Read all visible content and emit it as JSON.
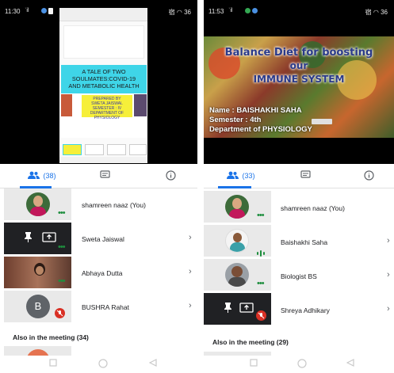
{
  "left_phone": {
    "status": {
      "time": "11:30",
      "signal": "ʾil",
      "right": "宿 ◠ 36"
    },
    "presentation": {
      "title_line1": "A TALE OF TWO",
      "title_line2": "SOULMATES:COVID-19",
      "title_line3": "AND METABOLIC HEALTH",
      "prepared_line1": "PREPARED BY",
      "prepared_line2": "SWETA JAISWAL",
      "prepared_line3": "SEMESTER : IV",
      "prepared_line4": "DEPARTMENT OF PHYSIOLOGY"
    },
    "tabs": {
      "people_count": "(38)"
    },
    "participants": [
      {
        "name": "shamreen naaz (You)"
      },
      {
        "name": "Sweta Jaiswal"
      },
      {
        "name": "Abhaya Dutta"
      },
      {
        "name": "BUSHRA Rahat",
        "initial": "B"
      }
    ],
    "also_in_meeting": "Also in the meeting (34)"
  },
  "right_phone": {
    "status": {
      "time": "11:53",
      "signal": "ʾil",
      "right": "宿 ◠ 36"
    },
    "presentation": {
      "title_line1": "Balance Diet for boosting",
      "title_line2": "our",
      "title_line3": "IMMUNE SYSTEM",
      "name_line": "Name : BAISHAKHI SAHA",
      "semester_line": "Semester : 4th",
      "department_line": "Department of PHYSIOLOGY"
    },
    "tabs": {
      "people_count": "(33)"
    },
    "participants": [
      {
        "name": "shamreen naaz (You)"
      },
      {
        "name": "Baishakhi Saha"
      },
      {
        "name": "Biologist BS"
      },
      {
        "name": "Shreya Adhikary"
      }
    ],
    "also_in_meeting": "Also in the meeting (29)"
  },
  "colors": {
    "accent": "#1a73e8",
    "talk_green": "#1e8e3e",
    "mic_off_red": "#d93025",
    "bushra_avatar": "#5f6368"
  },
  "icons": [
    "people-icon",
    "chat-icon",
    "info-icon",
    "pin-icon",
    "present-icon",
    "mic-off-icon",
    "chevron-right-icon"
  ]
}
